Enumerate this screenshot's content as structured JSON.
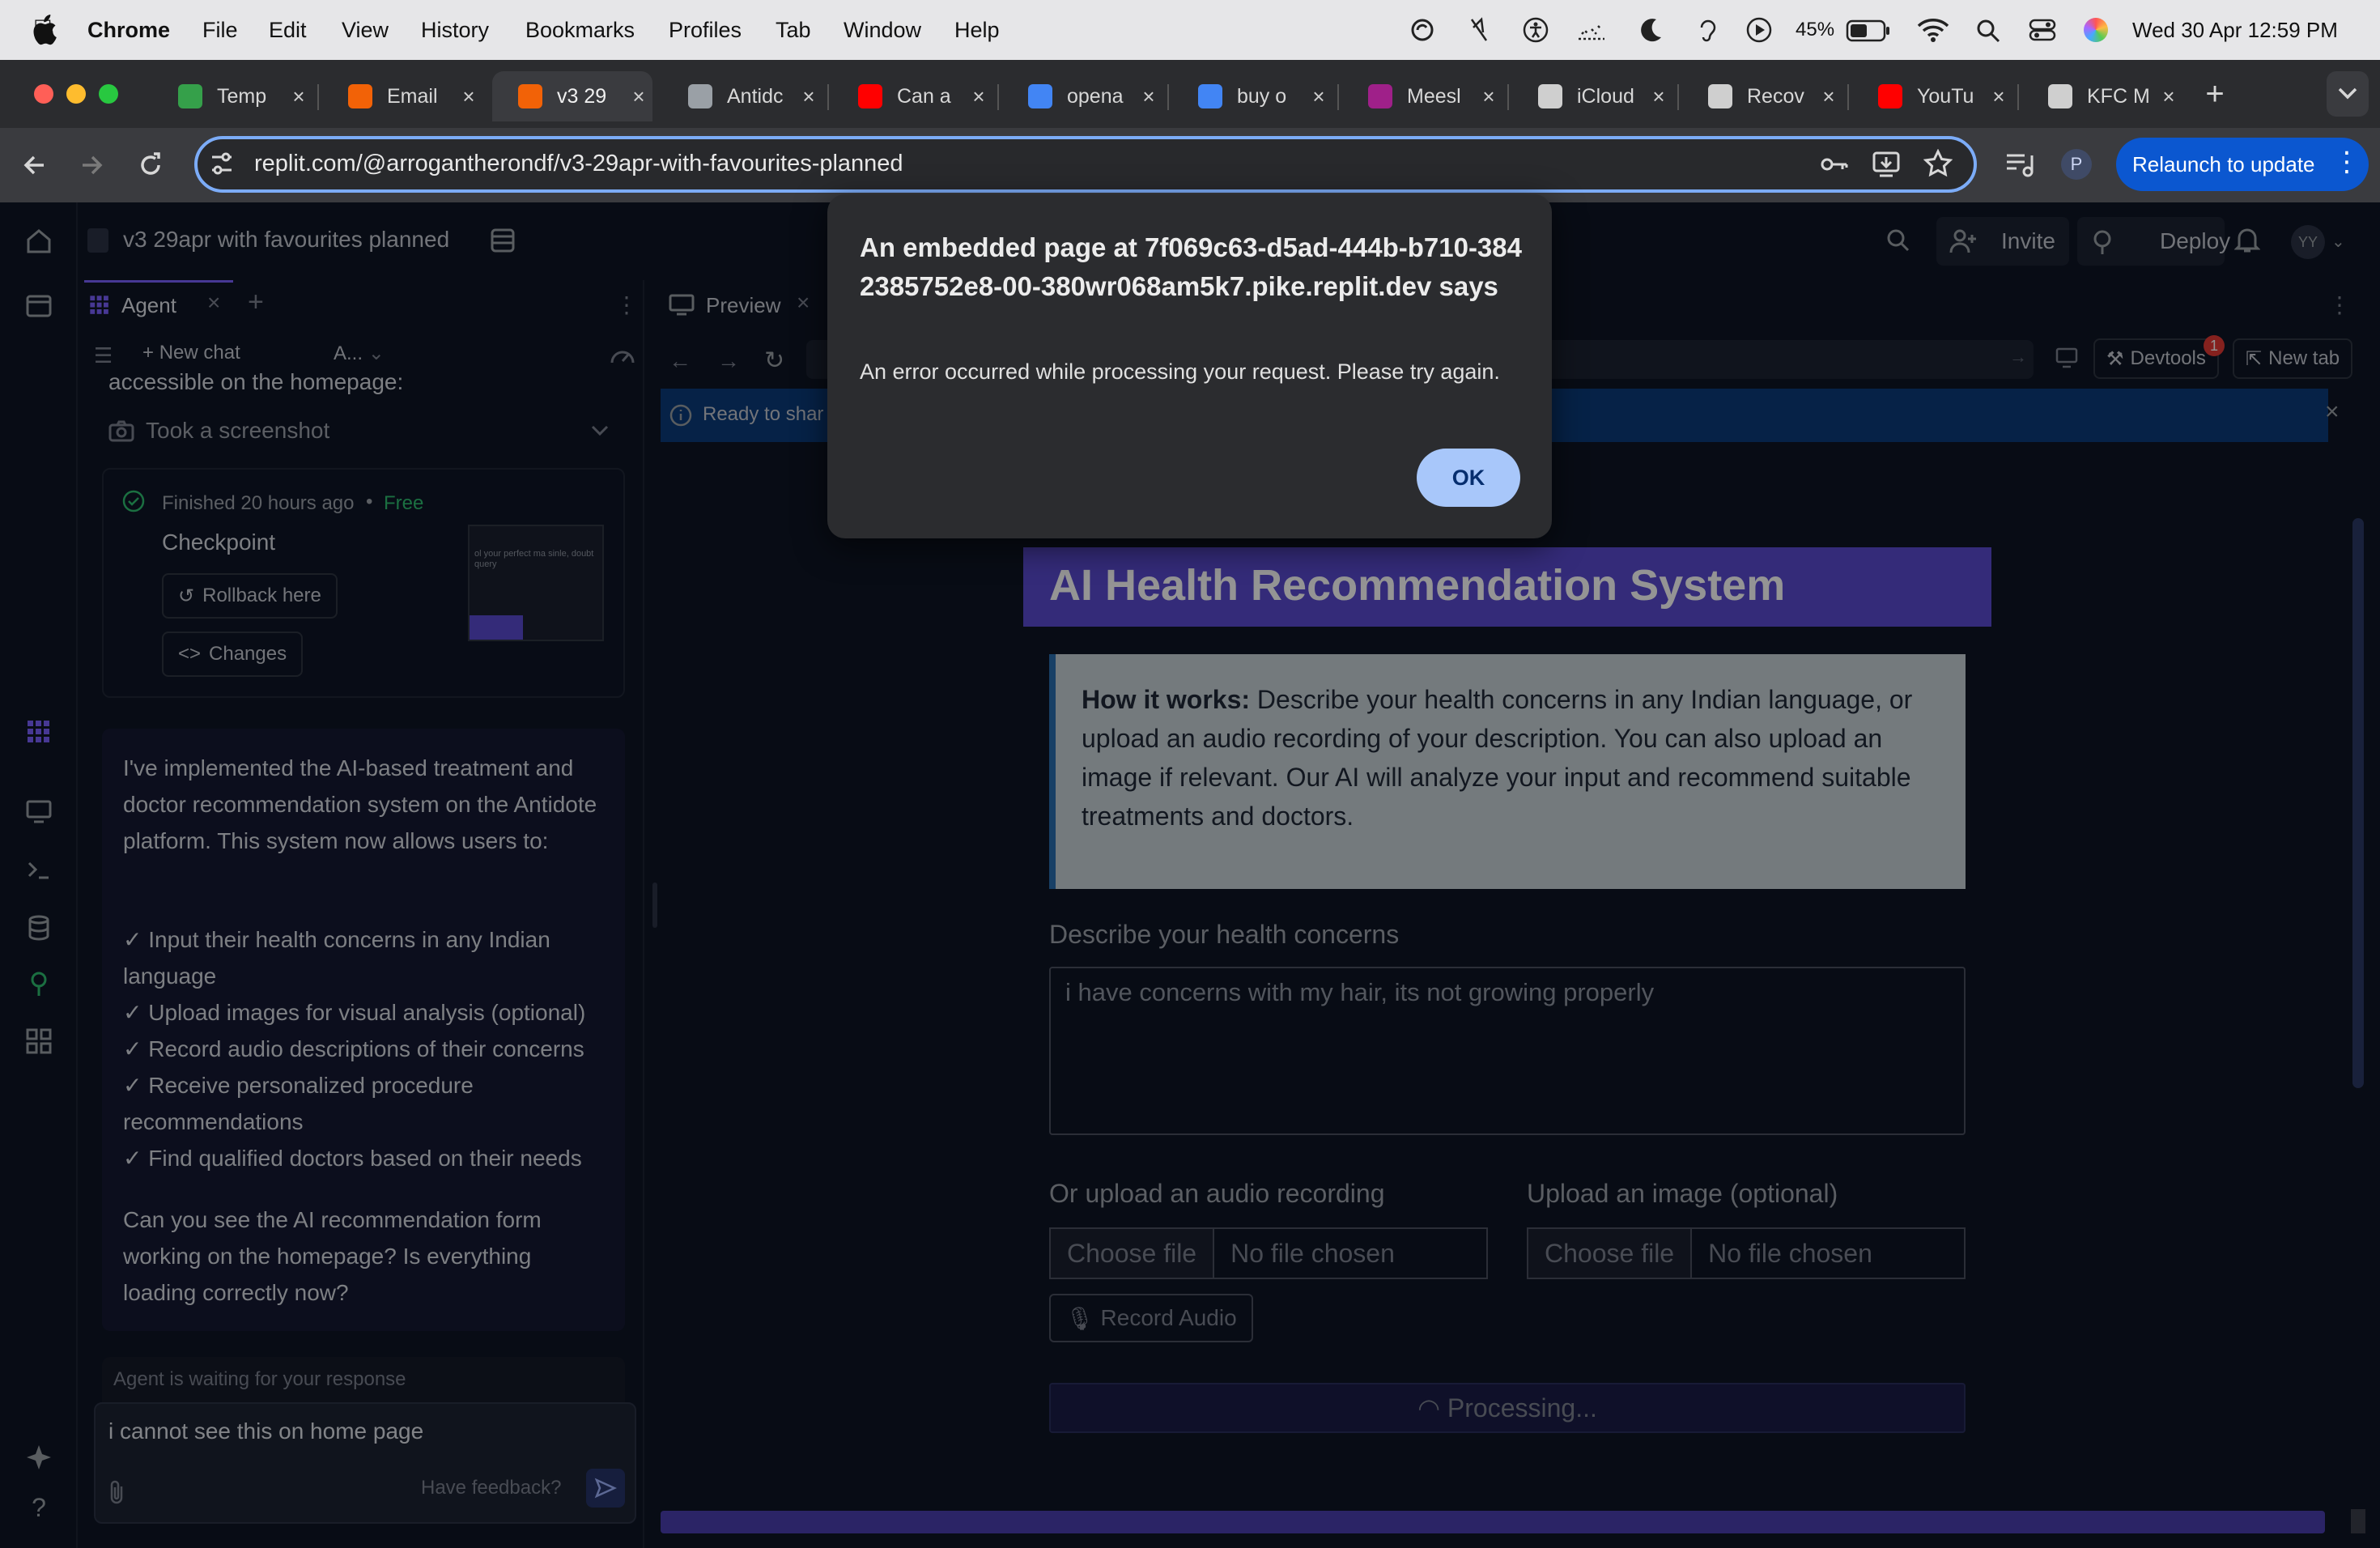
{
  "menubar": {
    "app": "Chrome",
    "items": [
      "File",
      "Edit",
      "View",
      "History",
      "Bookmarks",
      "Profiles",
      "Tab",
      "Window",
      "Help"
    ],
    "battery": "45%",
    "datetime": "Wed 30 Apr  12:59 PM"
  },
  "tabs": [
    {
      "label": "Temp",
      "icon": "shield-icon",
      "color": "#35a04a"
    },
    {
      "label": "Email",
      "icon": "replit-icon",
      "color": "#f26207"
    },
    {
      "label": "v3 29",
      "icon": "replit-icon",
      "color": "#f26207",
      "active": true
    },
    {
      "label": "Antidc",
      "icon": "globe-icon",
      "color": "#9aa0a6"
    },
    {
      "label": "Can a",
      "icon": "youtube-icon",
      "color": "#ff0000"
    },
    {
      "label": "opena",
      "icon": "google-icon",
      "color": "#4285f4"
    },
    {
      "label": "buy o",
      "icon": "google-icon",
      "color": "#4285f4"
    },
    {
      "label": "Meesl",
      "icon": "meesho-icon",
      "color": "#9f2089"
    },
    {
      "label": "iCloud",
      "icon": "apple-icon",
      "color": "#cfcfcf"
    },
    {
      "label": "Recov",
      "icon": "apple-icon",
      "color": "#cfcfcf"
    },
    {
      "label": "YouTu",
      "icon": "youtube-icon",
      "color": "#ff0000"
    },
    {
      "label": "KFC M",
      "icon": "globe-icon",
      "color": "#cfcfcf"
    }
  ],
  "browser": {
    "url": "replit.com/@arrogantherondf/v3-29apr-with-favourites-planned",
    "relaunch": "Relaunch to update",
    "profile": "P"
  },
  "replit": {
    "project": "v3 29apr with favourites planned",
    "invite": "Invite",
    "deploy": "Deploy",
    "avatar": "YY",
    "agent_tab": "Agent",
    "new_chat": "New chat",
    "model": "A...",
    "chat": {
      "cut_text": "accessible on the homepage:",
      "screenshot": "Took a screenshot",
      "finished": "Finished 20 hours ago",
      "free": "Free",
      "checkpoint": "Checkpoint",
      "rollback": "Rollback here",
      "changes": "Changes",
      "thumb_text": "ol your perfect ma sinle, doubt query",
      "message_intro": "I've implemented the AI-based treatment and doctor recommendation system on the Antidote platform. This system now allows users to:",
      "bullets": [
        "✓ Input their health concerns in any Indian language",
        "✓ Upload images for visual analysis (optional)",
        "✓ Record audio descriptions of their concerns",
        "✓ Receive personalized procedure recommendations",
        "✓ Find qualified doctors based on their needs"
      ],
      "message_outro": "Can you see the AI recommendation form working on the homepage? Is everything loading correctly now?",
      "waiting": "Agent is waiting for your response",
      "input_value": "i cannot see this on home page",
      "feedback": "Have feedback?"
    },
    "preview": {
      "tab": "Preview",
      "devtools": "Devtools",
      "devtools_badge": "1",
      "new_tab": "New tab",
      "banner": "Ready to shar",
      "app_title": "AI Health Recommendation System",
      "how_bold": "How it works:",
      "how_text": " Describe your health concerns in any Indian language, or upload an audio recording of your description. You can also upload an image if relevant. Our AI will analyze your input and recommend suitable treatments and doctors.",
      "describe_label": "Describe your health concerns",
      "describe_value": "i have concerns with my hair, its not growing properly",
      "audio_label": "Or upload an audio recording",
      "image_label": "Upload an image (optional)",
      "choose_file": "Choose file",
      "no_file": "No file chosen",
      "record": "Record Audio",
      "processing": "Processing..."
    }
  },
  "dialog": {
    "title": "An embedded page at 7f069c63-d5ad-444b-b710-3842385752e8-00-380wr068am5k7.pike.replit.dev says",
    "message": "An error occurred while processing your request. Please try again.",
    "ok": "OK"
  }
}
